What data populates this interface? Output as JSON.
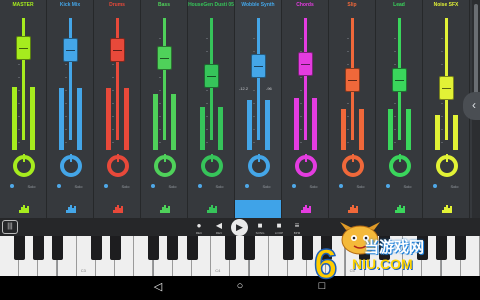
{
  "strips": [
    {
      "name": "MASTER",
      "color": "#a6ec1e",
      "level": 0.9
    },
    {
      "name": "Kick Mix",
      "color": "#44a6e8",
      "level": 0.88
    },
    {
      "name": "Drums",
      "color": "#e8493a",
      "level": 0.88
    },
    {
      "name": "Bass",
      "color": "#4fd15a",
      "level": 0.8
    },
    {
      "name": "HouseGen Dusti 05",
      "color": "#36c45a",
      "level": 0.62
    },
    {
      "name": "Wobble Synth",
      "color": "#44a6e8",
      "level": 0.72
    },
    {
      "name": "Chords",
      "color": "#e43ce0",
      "level": 0.74
    },
    {
      "name": "Slip",
      "color": "#f0683a",
      "level": 0.58
    },
    {
      "name": "Lead",
      "color": "#3ad65c",
      "level": 0.58
    },
    {
      "name": "Noise SFX",
      "color": "#e2f236",
      "level": 0.5
    }
  ],
  "solo_label": "Solo",
  "values": {
    "left": "-12.2",
    "right": "-96"
  },
  "sidetab_icon": "chevron-left-icon",
  "toolbar": {
    "menu_icon": "mixer-menu-icon",
    "buttons": [
      {
        "icon": "record-icon",
        "glyph": "●",
        "label": "REC"
      },
      {
        "icon": "rewind-icon",
        "glyph": "◀",
        "label": "REV"
      },
      {
        "icon": "play-icon",
        "glyph": "▶",
        "label": ""
      },
      {
        "icon": "pattern-icon",
        "glyph": "■",
        "label": "SONG"
      },
      {
        "icon": "stop-icon",
        "glyph": "■",
        "label": "LOOP"
      },
      {
        "icon": "tempo-icon",
        "glyph": "≡",
        "label": "BPM"
      }
    ]
  },
  "piano": {
    "octaves": [
      "C3",
      "C4",
      "C5"
    ]
  },
  "nav": {
    "back_glyph": "◁",
    "home_glyph": "○",
    "recents_glyph": "□"
  },
  "watermark": {
    "brand": "6",
    "text": "当游戏网",
    "url": "NIU.COM"
  }
}
